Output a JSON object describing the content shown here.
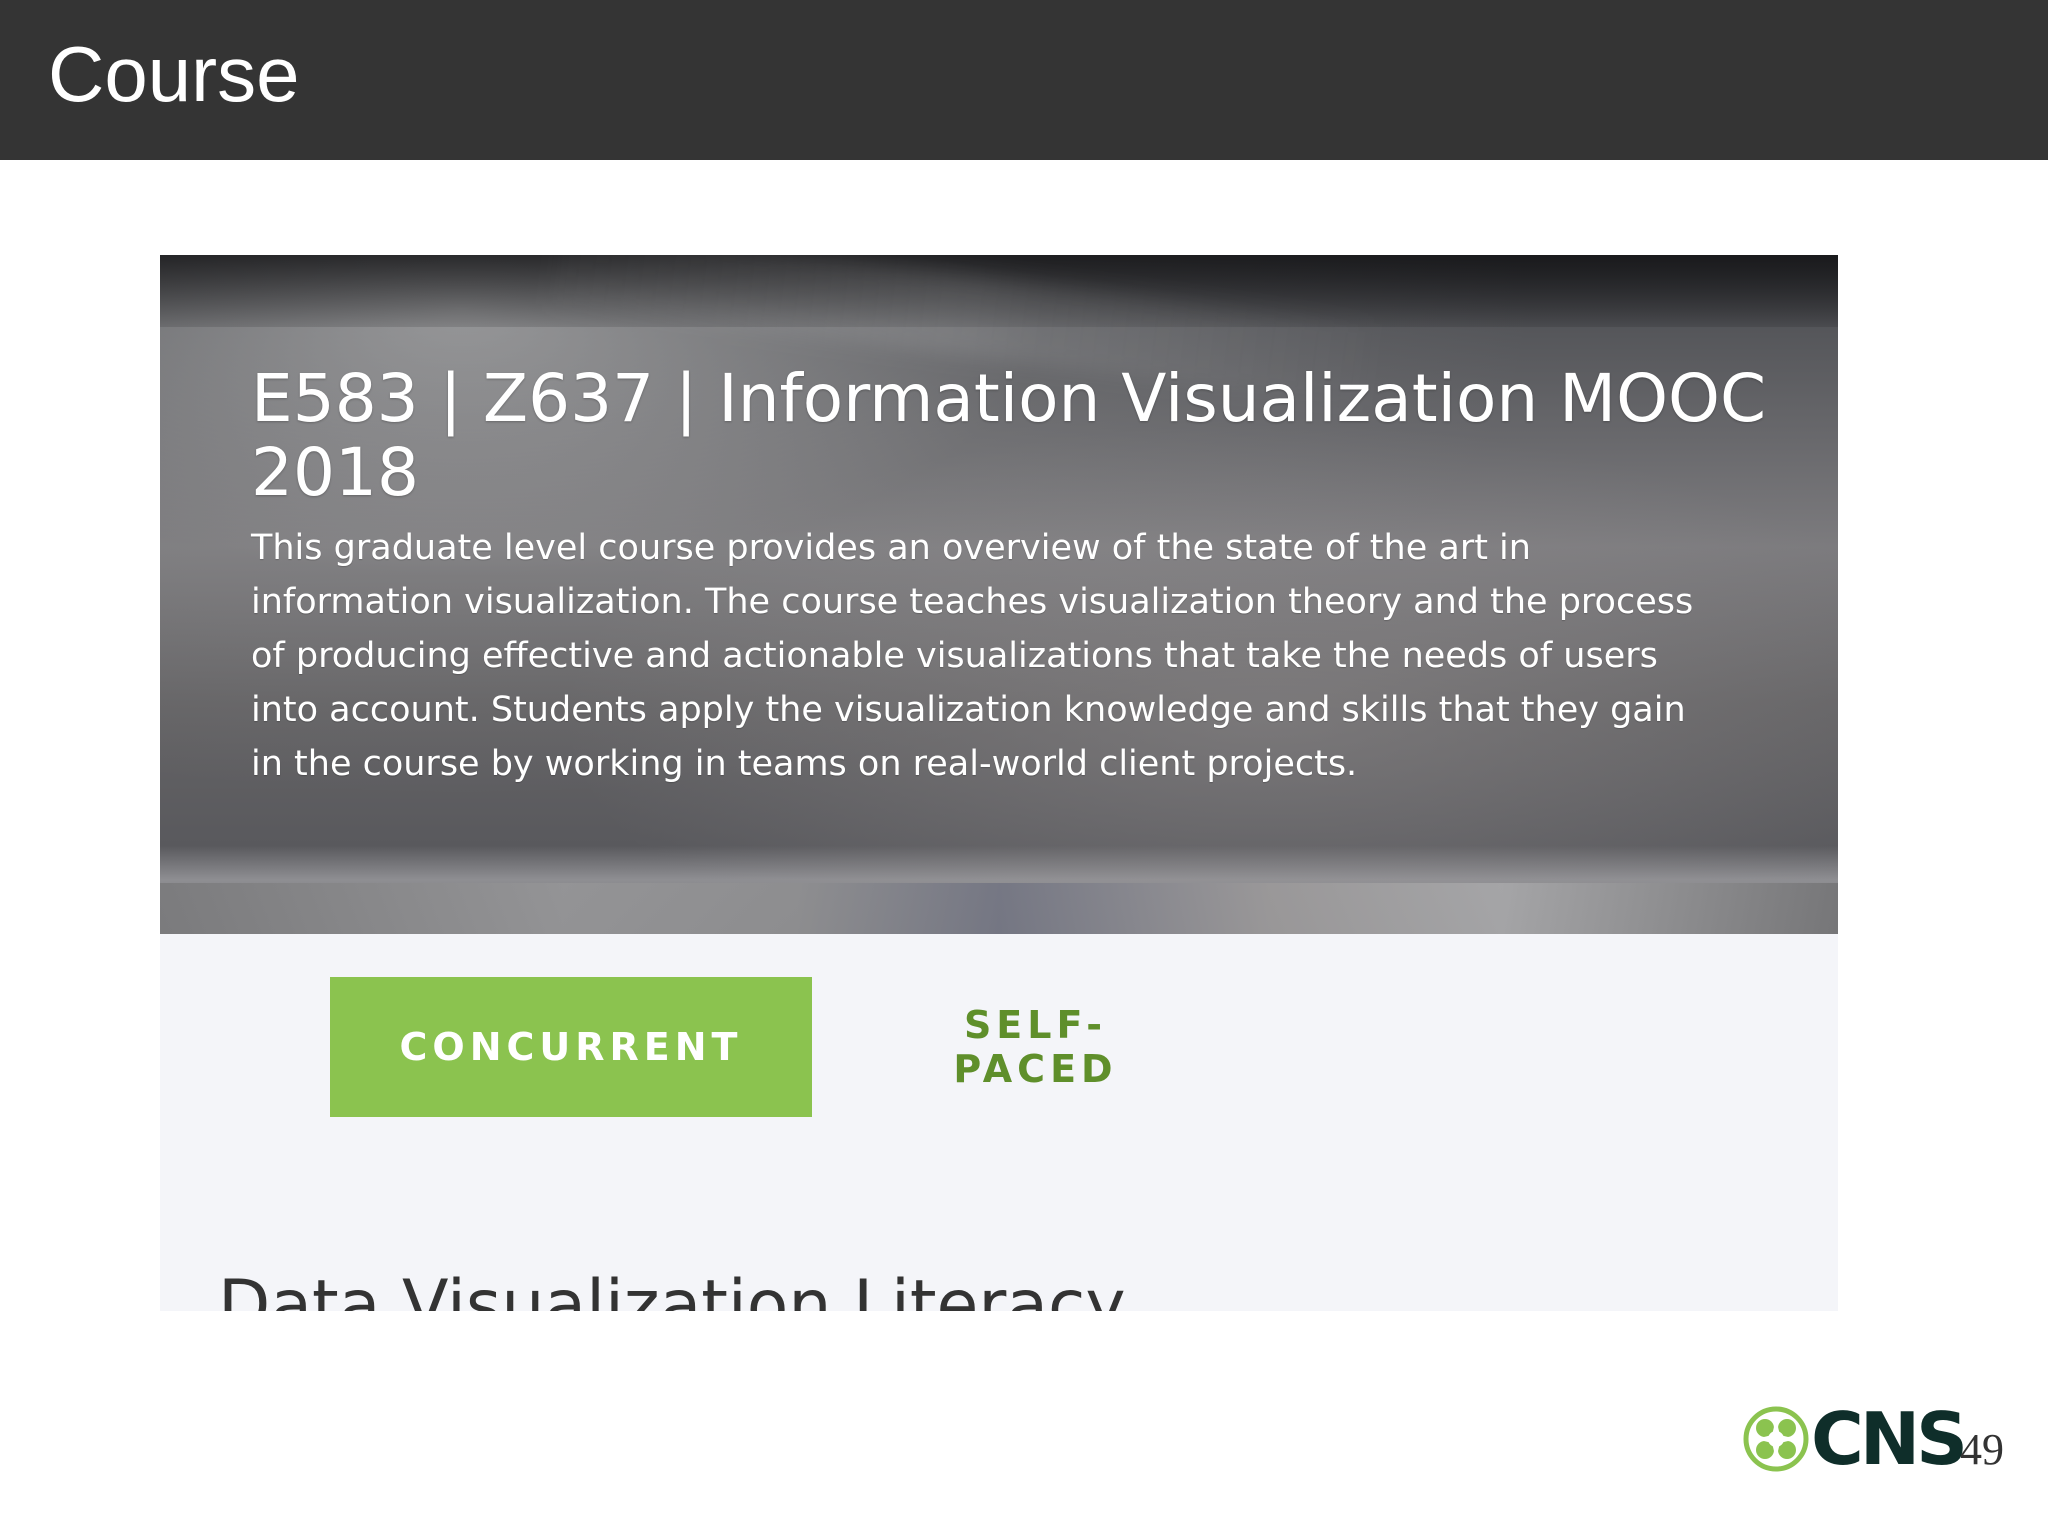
{
  "slide": {
    "title": "Course",
    "page_number": "49"
  },
  "screenshot": {
    "course_title": "E583 | Z637 | Information Visualization MOOC 2018",
    "course_description": "This graduate level course provides an overview of the state of the art in information visualization. The course teaches visualization theory and the process of producing effective and actionable visualizations that take the needs of users into account. Students apply the visualization knowledge and skills that they gain in the course by working in teams on real-world client projects.",
    "tabs": [
      {
        "label": "CONCURRENT",
        "selected": true
      },
      {
        "label": "SELF-PACED",
        "selected": false
      }
    ],
    "section_heading": "Data Visualization Literacy"
  },
  "logo": {
    "text": "CNS",
    "icon": "cns-clover-icon",
    "colors": {
      "green": "#8bc34f",
      "dark": "#0f2e2a"
    }
  },
  "colors": {
    "header_background": "#343434",
    "accent_green": "#8bc34f",
    "tab_text_green": "#5f8f2b",
    "content_background": "#f4f5f9"
  }
}
